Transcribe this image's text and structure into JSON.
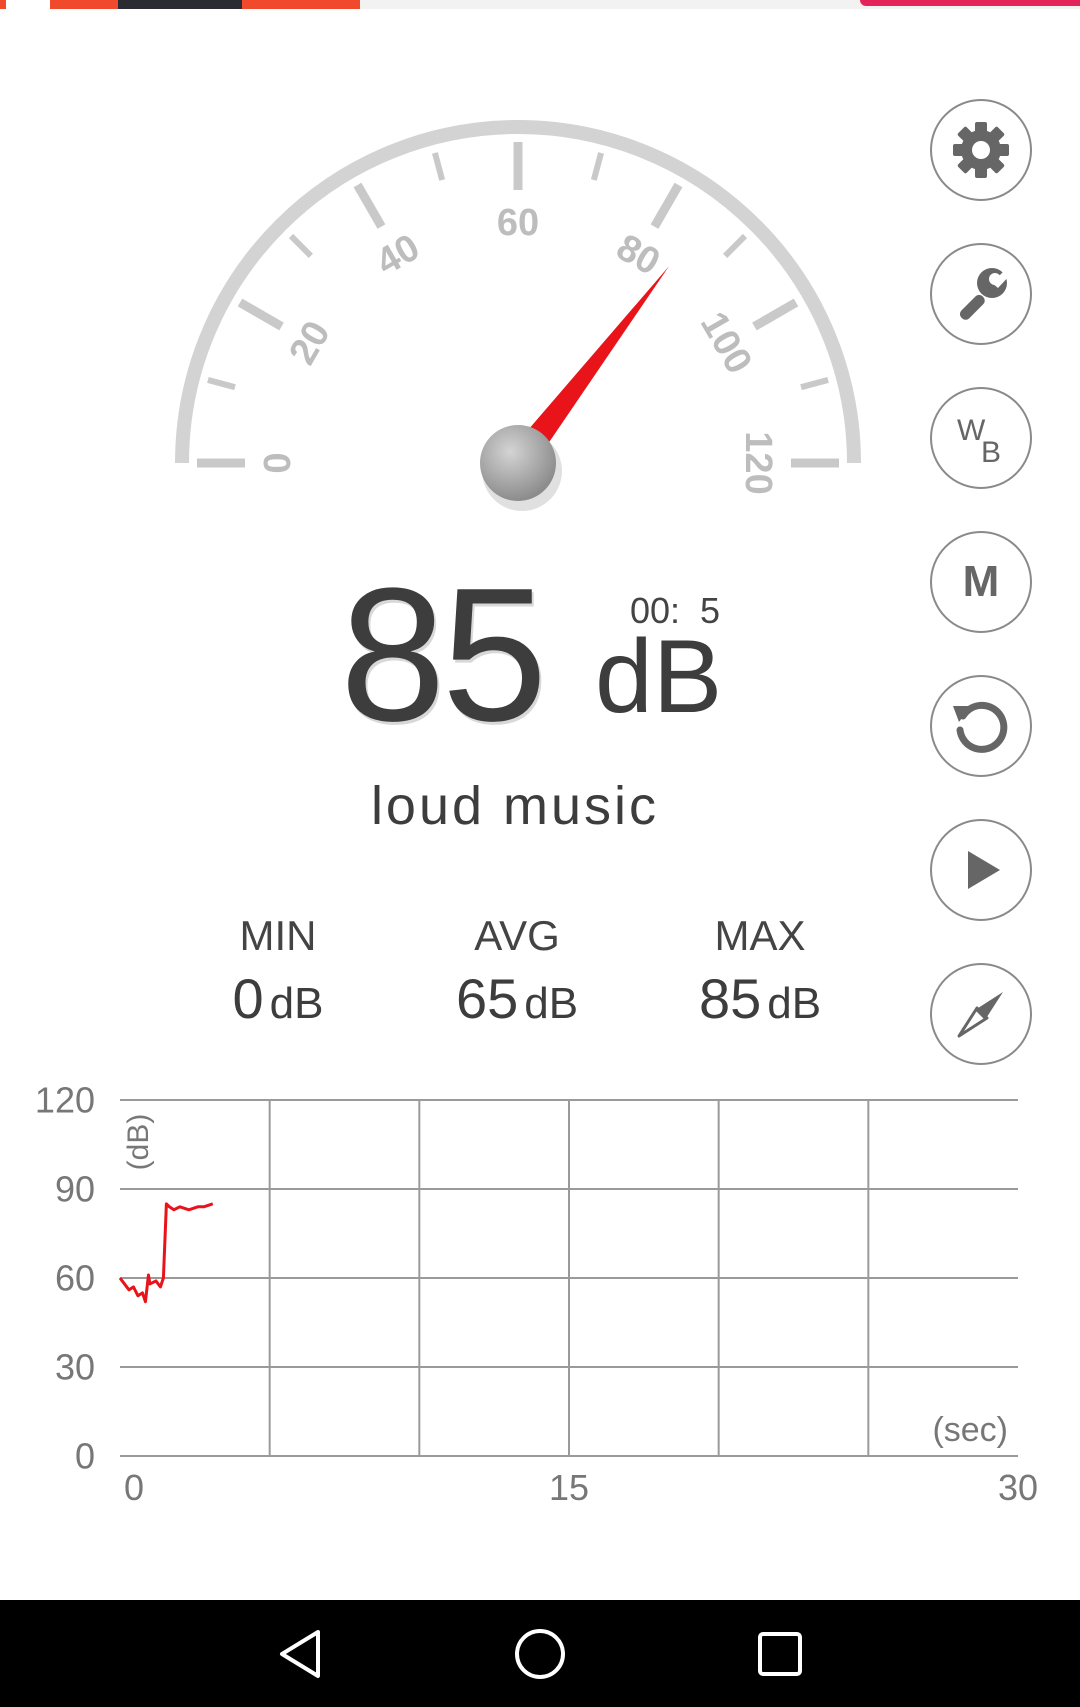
{
  "gauge": {
    "tick_labels": [
      "0",
      "20",
      "40",
      "60",
      "80",
      "100",
      "120"
    ],
    "range": [
      0,
      120
    ],
    "needle_value": 85,
    "needle_color": "#e8141a"
  },
  "reading": {
    "value": "85",
    "unit": "dB",
    "timer": "00:  5"
  },
  "status": "loud music",
  "stats": {
    "min": {
      "label": "MIN",
      "value": "0",
      "unit": "dB"
    },
    "avg": {
      "label": "AVG",
      "value": "65",
      "unit": "dB"
    },
    "max": {
      "label": "MAX",
      "value": "85",
      "unit": "dB"
    }
  },
  "side_buttons": [
    {
      "name": "settings-button",
      "icon": "gear-icon"
    },
    {
      "name": "tools-button",
      "icon": "wrench-icon"
    },
    {
      "name": "weighting-button",
      "icon": "wb-icon",
      "w": "W",
      "b": "B"
    },
    {
      "name": "mode-button",
      "icon": "m-icon",
      "label": "M"
    },
    {
      "name": "reset-button",
      "icon": "refresh-icon"
    },
    {
      "name": "play-button",
      "icon": "play-icon"
    },
    {
      "name": "compass-button",
      "icon": "compass-icon"
    }
  ],
  "chart_data": {
    "type": "line",
    "ylabel": "(dB)",
    "xlabel": "(sec)",
    "yticks": [
      "120",
      "90",
      "60",
      "30",
      "0"
    ],
    "xticks": [
      "0",
      "15",
      "30"
    ],
    "ylim": [
      0,
      120
    ],
    "xlim": [
      0,
      30
    ],
    "grid": true,
    "series": [
      {
        "color": "#e8141a",
        "x": [
          0,
          0.15,
          0.3,
          0.45,
          0.6,
          0.75,
          0.85,
          0.95,
          1.0,
          1.2,
          1.35,
          1.45,
          1.55,
          1.65,
          1.8,
          2.0,
          2.3,
          2.6,
          2.8,
          3.1
        ],
        "y": [
          60,
          58,
          56,
          57,
          54,
          55,
          52,
          61,
          58,
          59,
          57,
          60,
          85,
          84,
          83,
          84,
          83,
          84,
          84,
          85
        ]
      }
    ]
  },
  "navbar": {
    "back": "back-icon",
    "home": "home-icon",
    "recents": "recents-icon"
  }
}
